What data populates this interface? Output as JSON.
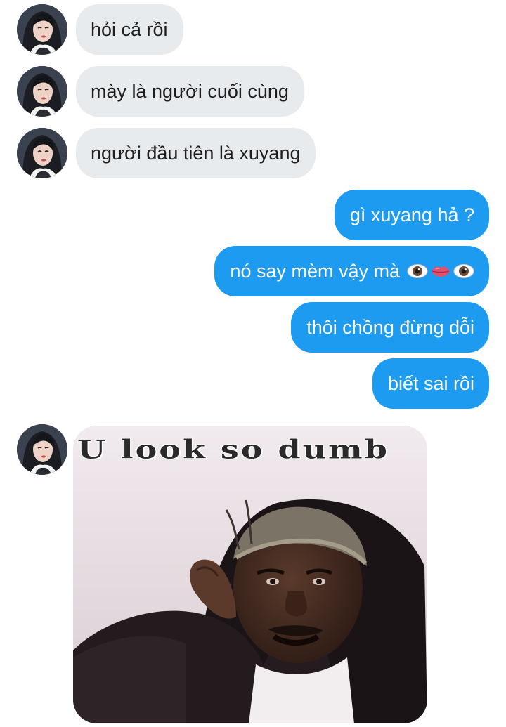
{
  "conversation": {
    "incoming": [
      {
        "text": "hỏi cả rồi"
      },
      {
        "text": "mày là người cuối cùng"
      },
      {
        "text": "người đầu tiên là xuyang"
      }
    ],
    "outgoing": [
      {
        "text": "gì xuyang hả ?"
      },
      {
        "text": "nó say mèm vậy mà",
        "emoji": [
          "eye-icon",
          "lips-icon",
          "eye-icon"
        ]
      },
      {
        "text": "thôi chồng đừng dỗi"
      },
      {
        "text": "biết sai rồi"
      }
    ],
    "gif": {
      "caption": "U look so dumb"
    }
  },
  "colors": {
    "incoming_bubble": "#e8ebee",
    "outgoing_bubble": "#1d9bf0",
    "incoming_text": "#1f1f1f",
    "outgoing_text": "#ffffff"
  }
}
